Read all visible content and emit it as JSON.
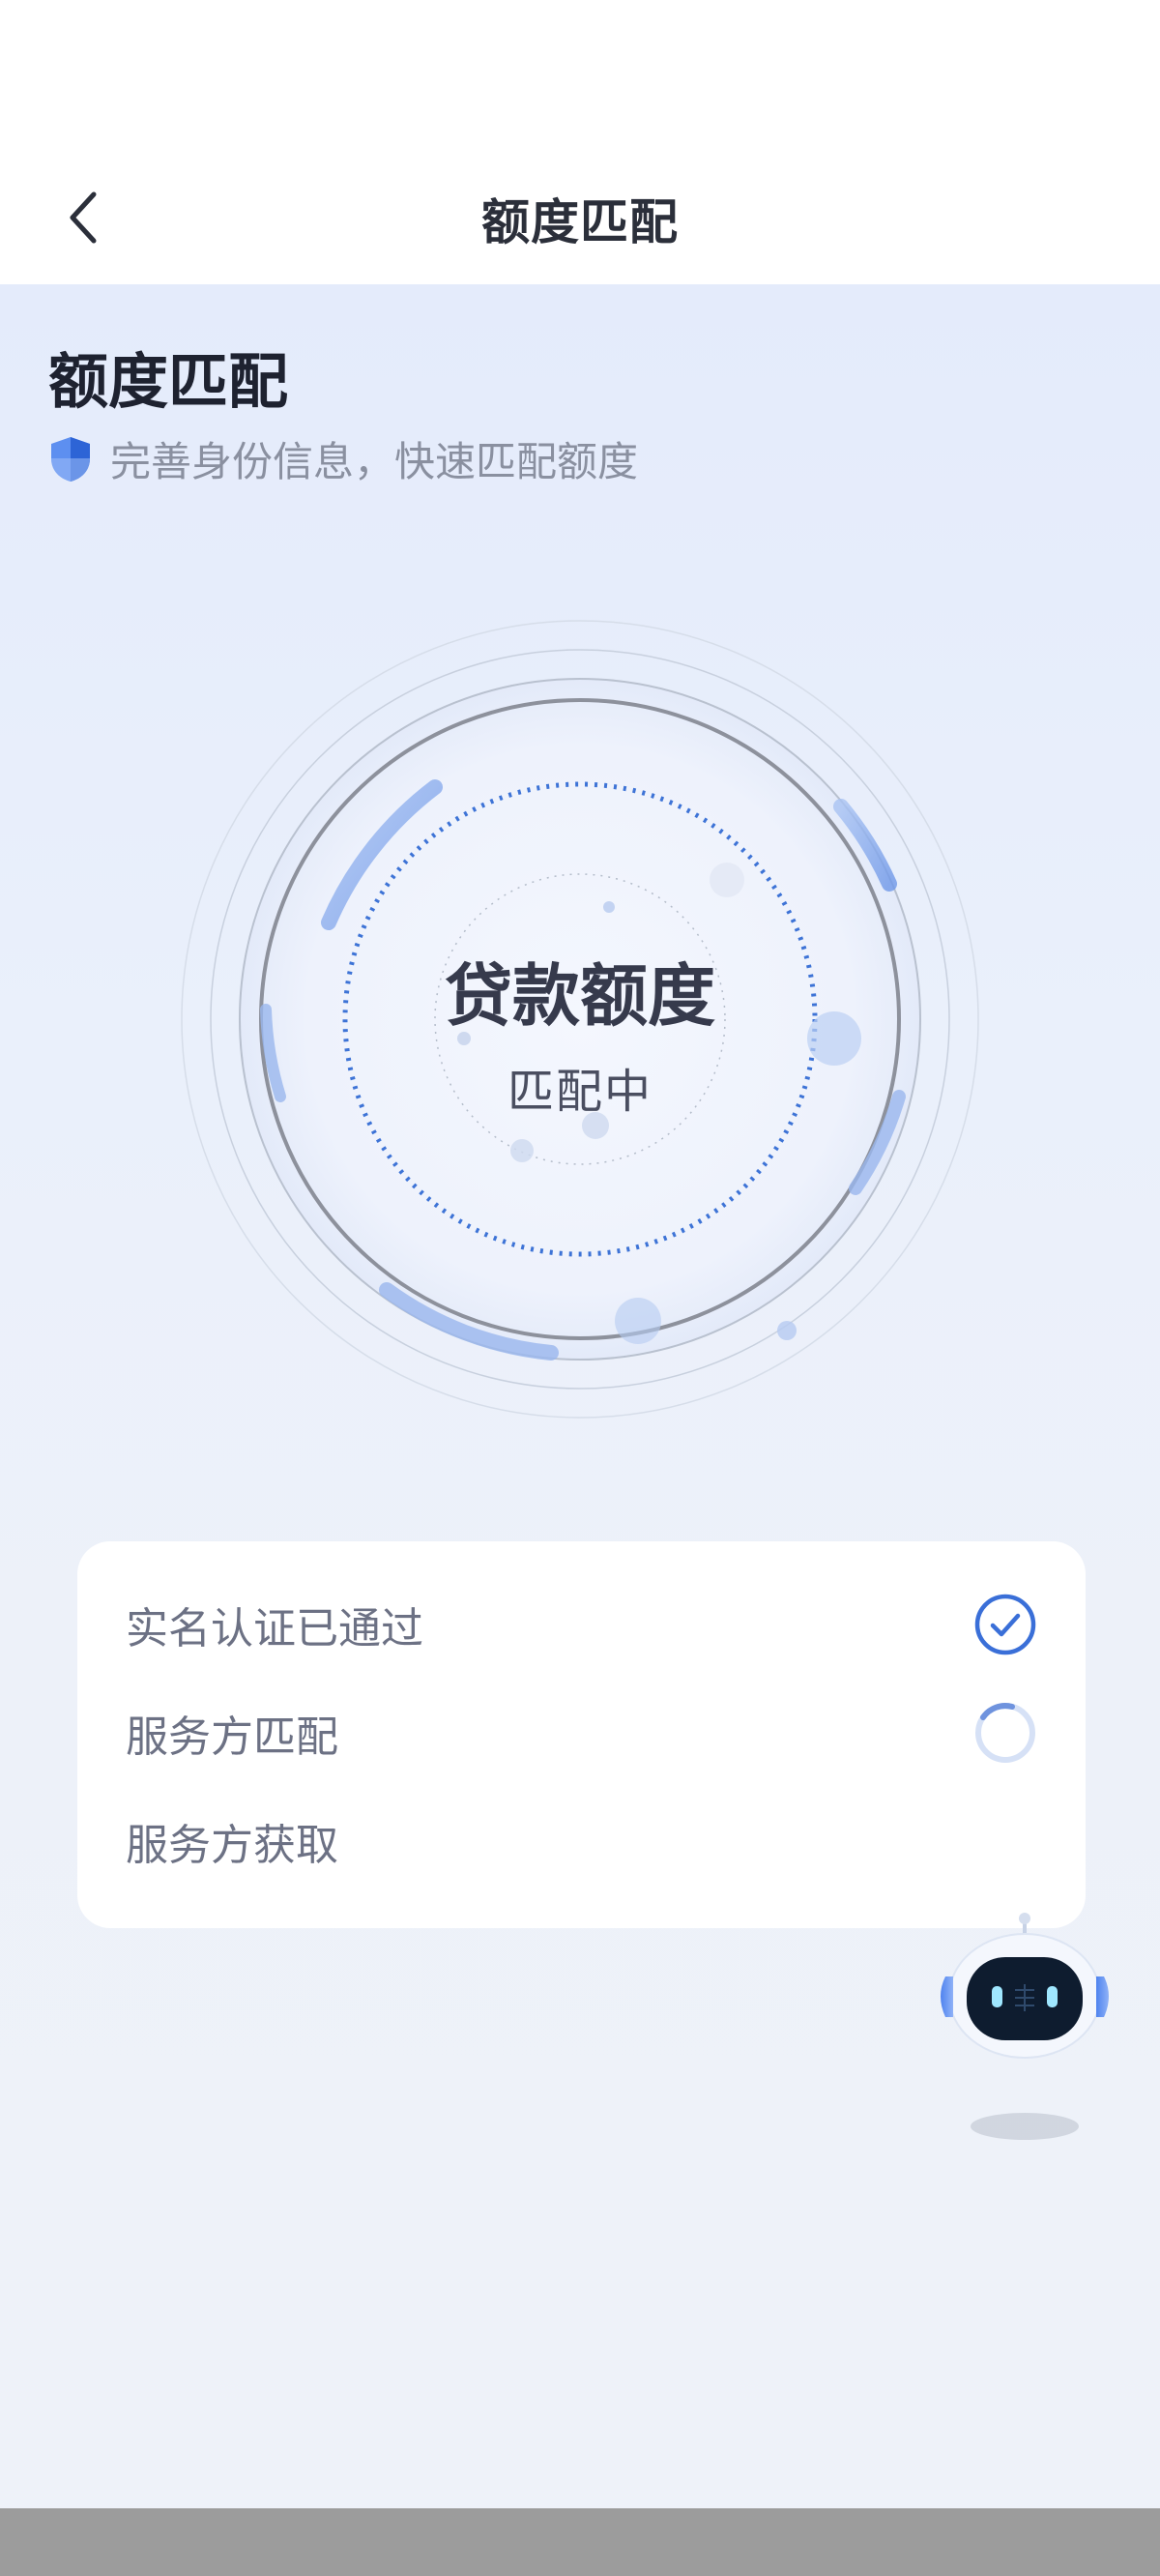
{
  "nav": {
    "title": "额度匹配",
    "back_icon": "chevron-left-icon"
  },
  "header": {
    "heading": "额度匹配",
    "subtitle": "完善身份信息，快速匹配额度",
    "subtitle_icon": "shield-icon"
  },
  "progress_ring": {
    "title": "贷款额度",
    "status": "匹配中"
  },
  "steps": [
    {
      "label": "实名认证已通过",
      "state": "done",
      "icon": "check-circle-icon"
    },
    {
      "label": "服务方匹配",
      "state": "loading",
      "icon": "spinner-icon"
    },
    {
      "label": "服务方获取",
      "state": "pending",
      "icon": ""
    }
  ],
  "assistant": {
    "icon": "robot-assistant-icon"
  },
  "colors": {
    "accent": "#3a6fd8",
    "background": "#e9eefa",
    "text_primary": "#1e2230",
    "text_secondary": "#8a90a0"
  }
}
